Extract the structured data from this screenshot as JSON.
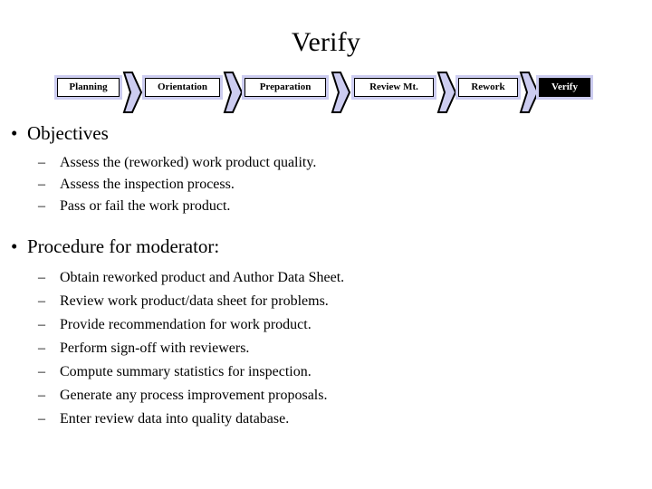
{
  "slide": {
    "title": "Verify"
  },
  "process_flow": {
    "arrow_icon": "chevron-right-arrow",
    "fill_color": "#ccccf0",
    "current_step_bg": "#000000",
    "current_step_fg": "#ffffff",
    "steps": [
      {
        "label": "Planning",
        "current": false
      },
      {
        "label": "Orientation",
        "current": false
      },
      {
        "label": "Preparation",
        "current": false
      },
      {
        "label": "Review Mt.",
        "current": false
      },
      {
        "label": "Rework",
        "current": false
      },
      {
        "label": "Verify",
        "current": true
      }
    ]
  },
  "content": {
    "bullet_glyph": "•",
    "dash_glyph": "–",
    "sections": [
      {
        "heading": "Objectives",
        "items": [
          "Assess the (reworked) work product quality.",
          "Assess the inspection process.",
          "Pass or fail the work product."
        ]
      },
      {
        "heading": "Procedure for moderator:",
        "items": [
          "Obtain reworked product and Author Data Sheet.",
          "Review work product/data sheet for problems.",
          "Provide recommendation for work product.",
          "Perform sign-off with reviewers.",
          "Compute summary statistics for inspection.",
          "Generate any process improvement proposals.",
          "Enter review data into quality database."
        ]
      }
    ]
  }
}
